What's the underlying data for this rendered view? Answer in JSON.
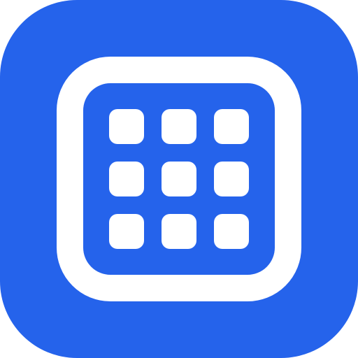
{
  "app_icon": {
    "icon_name": "grid-app-icon",
    "colors": {
      "background": "#2563EB",
      "foreground": "#FFFFFF"
    },
    "grid": {
      "rows": 3,
      "columns": 3
    }
  }
}
